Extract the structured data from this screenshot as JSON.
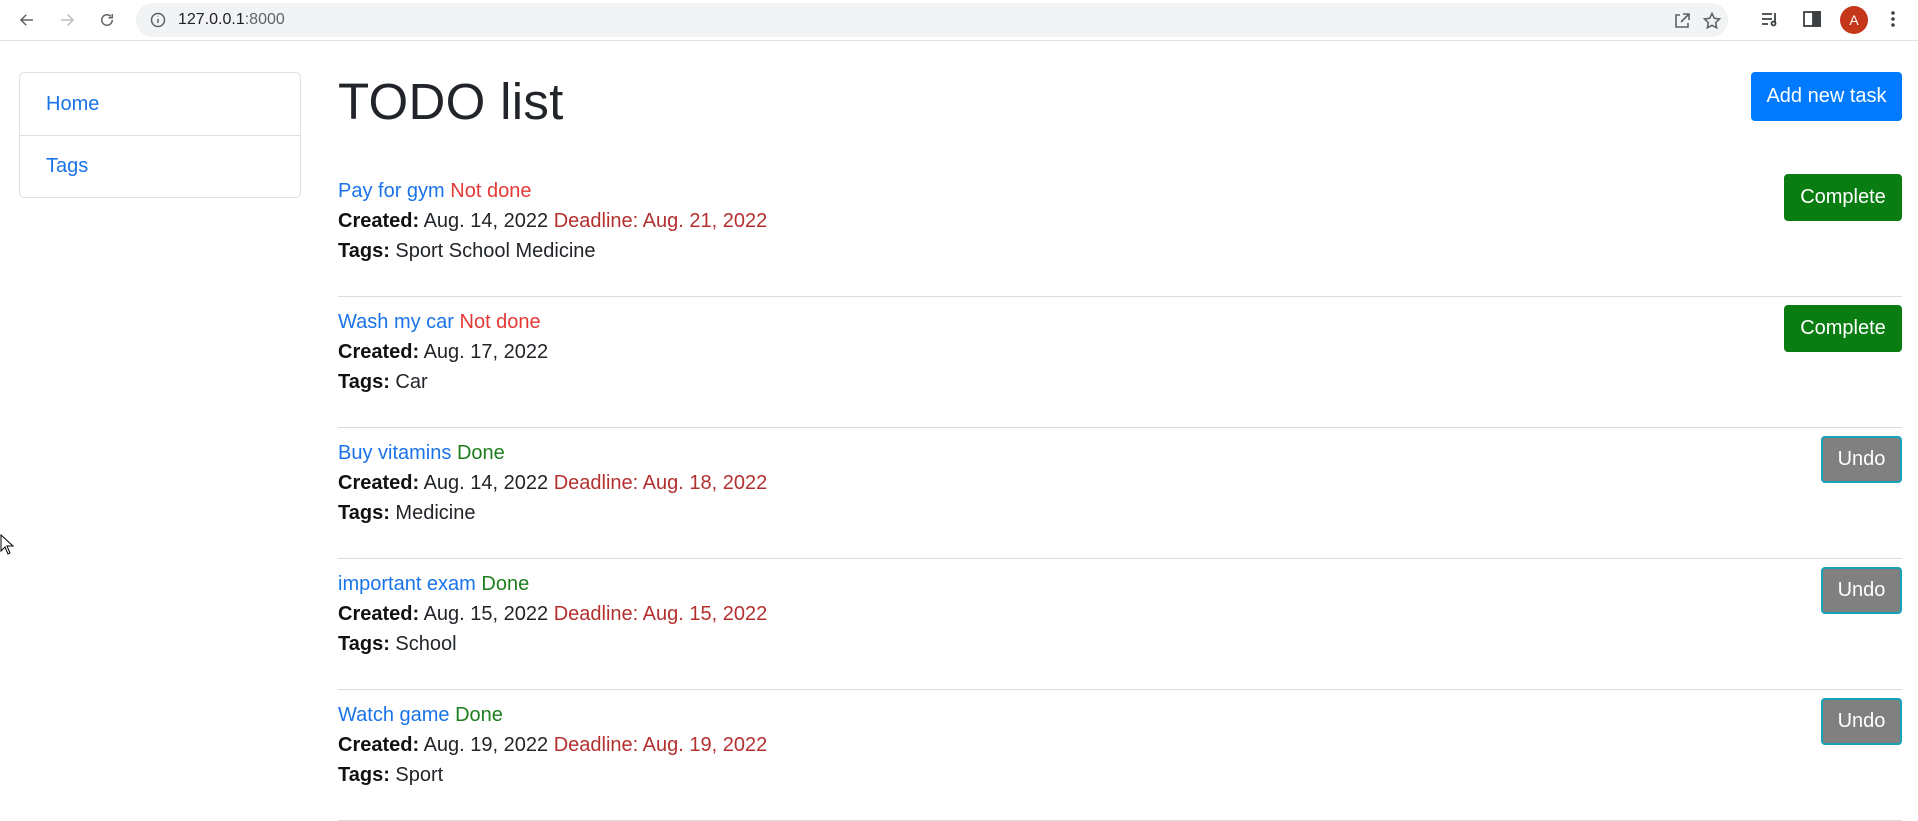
{
  "browser": {
    "url_host": "127.0.0.1",
    "url_port": ":8000",
    "icons": [
      "back-arrow-icon",
      "forward-arrow-icon",
      "reload-icon",
      "info-icon",
      "share-icon",
      "star-icon",
      "reading-list-icon",
      "side-panel-icon",
      "menu-dots-icon"
    ],
    "avatar_letter": "A",
    "avatar_color": "#c5361b"
  },
  "sidebar": {
    "items": [
      {
        "label": "Home"
      },
      {
        "label": "Tags"
      }
    ]
  },
  "main": {
    "title": "TODO list",
    "add_button": "Add new task",
    "created_label": "Created:",
    "tags_label": "Tags:",
    "tasks": [
      {
        "name": "Pay for gym",
        "status": "Not done",
        "created": "Aug. 14, 2022",
        "deadline": "Deadline: Aug. 21, 2022",
        "tags": "Sport School Medicine",
        "action": "Complete"
      },
      {
        "name": "Wash my car",
        "status": "Not done",
        "created": "Aug. 17, 2022",
        "deadline": "",
        "tags": "Car",
        "action": "Complete"
      },
      {
        "name": "Buy vitamins",
        "status": "Done",
        "created": "Aug. 14, 2022",
        "deadline": "Deadline: Aug. 18, 2022",
        "tags": "Medicine",
        "action": "Undo"
      },
      {
        "name": "important exam",
        "status": "Done",
        "created": "Aug. 15, 2022",
        "deadline": "Deadline: Aug. 15, 2022",
        "tags": "School",
        "action": "Undo"
      },
      {
        "name": "Watch game",
        "status": "Done",
        "created": "Aug. 19, 2022",
        "deadline": "Deadline: Aug. 19, 2022",
        "tags": "Sport",
        "action": "Undo"
      }
    ]
  },
  "colors": {
    "link": "#1a73e8",
    "not_done": "#e53935",
    "done": "#1e7e1e",
    "deadline": "#b3302f",
    "primary_button": "#007bff",
    "complete_button": "#0a7d12",
    "undo_button": "#808080"
  }
}
